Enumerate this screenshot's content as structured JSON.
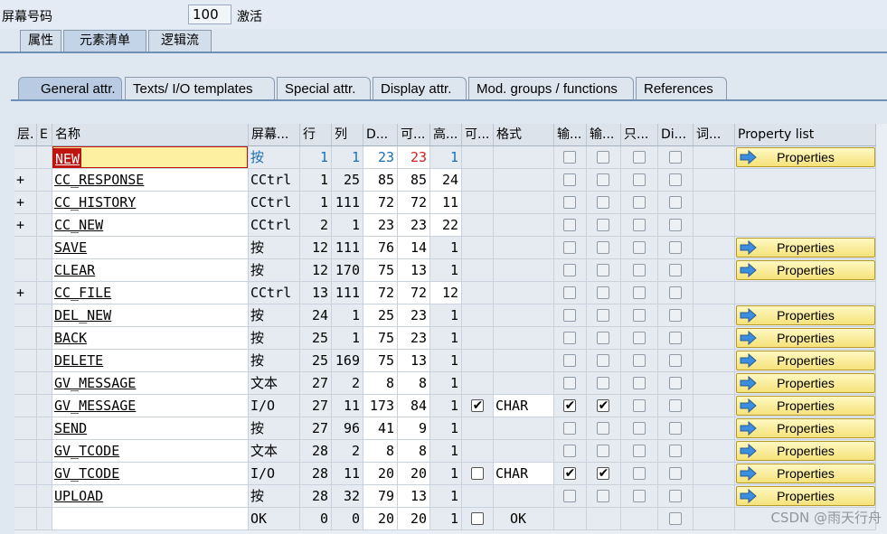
{
  "header": {
    "screen_label": "屏幕号码",
    "screen_number": "100",
    "screen_status": "激活"
  },
  "outer_tabs": [
    "属性",
    "元素清单",
    "逻辑流"
  ],
  "inner_tabs": [
    "General attr.",
    "Texts/ I/O templates",
    "Special attr.",
    "Display attr.",
    "Mod. groups / functions",
    "References"
  ],
  "columns": [
    "层.",
    "E",
    "名称",
    "屏幕...",
    "行",
    "列",
    "D...",
    "可...",
    "高...",
    "可...",
    "格式",
    "输...",
    "输...",
    "只...",
    "Di...",
    "词...",
    "Property list"
  ],
  "property_button_label": "Properties",
  "rows": [
    {
      "level": "",
      "name": "NEW",
      "type": "按",
      "line": "1",
      "col": "1",
      "dlen": "23",
      "vlen": "23",
      "height": "1",
      "scroll": false,
      "format": "",
      "in": false,
      "out": false,
      "ro": false,
      "di": false,
      "prop": true
    },
    {
      "level": "+",
      "name": "CC_RESPONSE",
      "type": "CCtrl",
      "line": "1",
      "col": "25",
      "dlen": "85",
      "vlen": "85",
      "height": "24",
      "scroll": false,
      "format": "",
      "in": false,
      "out": false,
      "ro": false,
      "di": false,
      "prop": false
    },
    {
      "level": "+",
      "name": "CC_HISTORY",
      "type": "CCtrl",
      "line": "1",
      "col": "111",
      "dlen": "72",
      "vlen": "72",
      "height": "11",
      "scroll": false,
      "format": "",
      "in": false,
      "out": false,
      "ro": false,
      "di": false,
      "prop": false
    },
    {
      "level": "+",
      "name": "CC_NEW",
      "type": "CCtrl",
      "line": "2",
      "col": "1",
      "dlen": "23",
      "vlen": "23",
      "height": "22",
      "scroll": false,
      "format": "",
      "in": false,
      "out": false,
      "ro": false,
      "di": false,
      "prop": false
    },
    {
      "level": "",
      "name": "SAVE",
      "type": "按",
      "line": "12",
      "col": "111",
      "dlen": "76",
      "vlen": "14",
      "height": "1",
      "scroll": false,
      "format": "",
      "in": false,
      "out": false,
      "ro": false,
      "di": false,
      "prop": true
    },
    {
      "level": "",
      "name": "CLEAR",
      "type": "按",
      "line": "12",
      "col": "170",
      "dlen": "75",
      "vlen": "13",
      "height": "1",
      "scroll": false,
      "format": "",
      "in": false,
      "out": false,
      "ro": false,
      "di": false,
      "prop": true
    },
    {
      "level": "+",
      "name": "CC_FILE",
      "type": "CCtrl",
      "line": "13",
      "col": "111",
      "dlen": "72",
      "vlen": "72",
      "height": "12",
      "scroll": false,
      "format": "",
      "in": false,
      "out": false,
      "ro": false,
      "di": false,
      "prop": false
    },
    {
      "level": "",
      "name": "DEL_NEW",
      "type": "按",
      "line": "24",
      "col": "1",
      "dlen": "25",
      "vlen": "23",
      "height": "1",
      "scroll": false,
      "format": "",
      "in": false,
      "out": false,
      "ro": false,
      "di": false,
      "prop": true
    },
    {
      "level": "",
      "name": "BACK",
      "type": "按",
      "line": "25",
      "col": "1",
      "dlen": "75",
      "vlen": "23",
      "height": "1",
      "scroll": false,
      "format": "",
      "in": false,
      "out": false,
      "ro": false,
      "di": false,
      "prop": true
    },
    {
      "level": "",
      "name": "DELETE",
      "type": "按",
      "line": "25",
      "col": "169",
      "dlen": "75",
      "vlen": "13",
      "height": "1",
      "scroll": false,
      "format": "",
      "in": false,
      "out": false,
      "ro": false,
      "di": false,
      "prop": true
    },
    {
      "level": "",
      "name": "GV_MESSAGE",
      "type": "文本",
      "line": "27",
      "col": "2",
      "dlen": "8",
      "vlen": "8",
      "height": "1",
      "scroll": false,
      "format": "",
      "in": false,
      "out": false,
      "ro": false,
      "di": false,
      "prop": true
    },
    {
      "level": "",
      "name": "GV_MESSAGE",
      "type": "I/O",
      "line": "27",
      "col": "11",
      "dlen": "173",
      "vlen": "84",
      "height": "1",
      "scroll": true,
      "format": "CHAR",
      "in": true,
      "out": true,
      "ro": false,
      "di": false,
      "prop": true
    },
    {
      "level": "",
      "name": "SEND",
      "type": "按",
      "line": "27",
      "col": "96",
      "dlen": "41",
      "vlen": "9",
      "height": "1",
      "scroll": false,
      "format": "",
      "in": false,
      "out": false,
      "ro": false,
      "di": false,
      "prop": true
    },
    {
      "level": "",
      "name": "GV_TCODE",
      "type": "文本",
      "line": "28",
      "col": "2",
      "dlen": "8",
      "vlen": "8",
      "height": "1",
      "scroll": false,
      "format": "",
      "in": false,
      "out": false,
      "ro": false,
      "di": false,
      "prop": true
    },
    {
      "level": "",
      "name": "GV_TCODE",
      "type": "I/O",
      "line": "28",
      "col": "11",
      "dlen": "20",
      "vlen": "20",
      "height": "1",
      "scroll": false,
      "format": "CHAR",
      "in": true,
      "out": true,
      "ro": false,
      "di": false,
      "prop": true
    },
    {
      "level": "",
      "name": "UPLOAD",
      "type": "按",
      "line": "28",
      "col": "32",
      "dlen": "79",
      "vlen": "13",
      "height": "1",
      "scroll": false,
      "format": "",
      "in": false,
      "out": false,
      "ro": false,
      "di": false,
      "prop": true
    },
    {
      "level": "",
      "name": "",
      "type": "OK",
      "line": "0",
      "col": "0",
      "dlen": "20",
      "vlen": "20",
      "height": "1",
      "scroll": false,
      "format": "OK",
      "in": null,
      "out": null,
      "ro": null,
      "di": false,
      "prop": false
    }
  ],
  "watermark": "CSDN @雨天行舟",
  "colors": {
    "selected_name": "#c0140f",
    "property_button": "#f5e27a",
    "tab_line": "#6f8fb7"
  }
}
